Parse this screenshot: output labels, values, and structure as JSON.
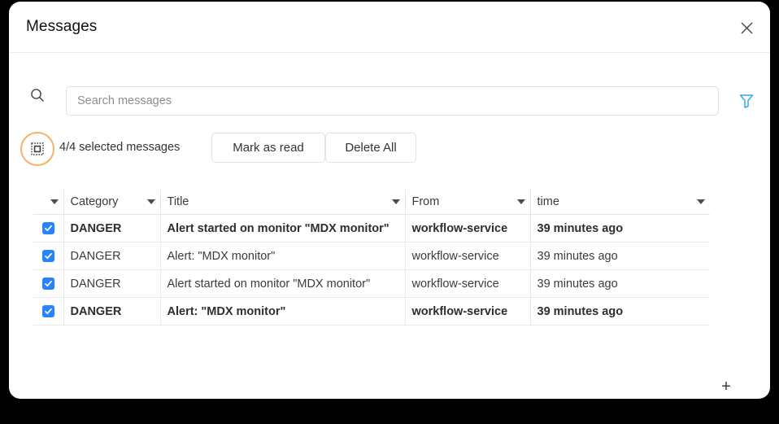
{
  "window": {
    "title": "Messages",
    "close_icon": "close-icon"
  },
  "search": {
    "icon": "search-icon",
    "placeholder": "Search messages",
    "value": "",
    "filter_icon": "filter-funnel-icon",
    "filter_color": "#2fa8f0"
  },
  "actions": {
    "select_all_icon": "select-all-square-icon",
    "highlight_color": "#f7b267",
    "selected_label": "4/4 selected messages",
    "mark_as_read_label": "Mark as read",
    "delete_all_label": "Delete All"
  },
  "table": {
    "add_column_label": "+",
    "columns": [
      {
        "key": "checkbox",
        "label": "",
        "sort_caret": "caret-down-icon"
      },
      {
        "key": "category",
        "label": "Category",
        "sort_caret": "caret-down-icon"
      },
      {
        "key": "title",
        "label": "Title",
        "sort_caret": "caret-down-icon"
      },
      {
        "key": "from",
        "label": "From",
        "sort_caret": "caret-down-icon"
      },
      {
        "key": "time",
        "label": "time",
        "sort_caret": "caret-down-icon"
      }
    ],
    "rows": [
      {
        "checked": true,
        "unread": true,
        "category": "DANGER",
        "title": "Alert started on monitor \"MDX monitor\"",
        "from": "workflow-service",
        "time": "39 minutes ago"
      },
      {
        "checked": true,
        "unread": false,
        "category": "DANGER",
        "title": "Alert: \"MDX monitor\"",
        "from": "workflow-service",
        "time": "39 minutes ago"
      },
      {
        "checked": true,
        "unread": false,
        "category": "DANGER",
        "title": "Alert started on monitor \"MDX monitor\"",
        "from": "workflow-service",
        "time": "39 minutes ago"
      },
      {
        "checked": true,
        "unread": true,
        "category": "DANGER",
        "title": "Alert: \"MDX monitor\"",
        "from": "workflow-service",
        "time": "39 minutes ago"
      }
    ]
  },
  "colors": {
    "checkbox_blue": "#2684ff",
    "accent_orange": "#f7b267",
    "filter_blue": "#2fa8f0",
    "background": "#000000",
    "card": "#ffffff"
  }
}
